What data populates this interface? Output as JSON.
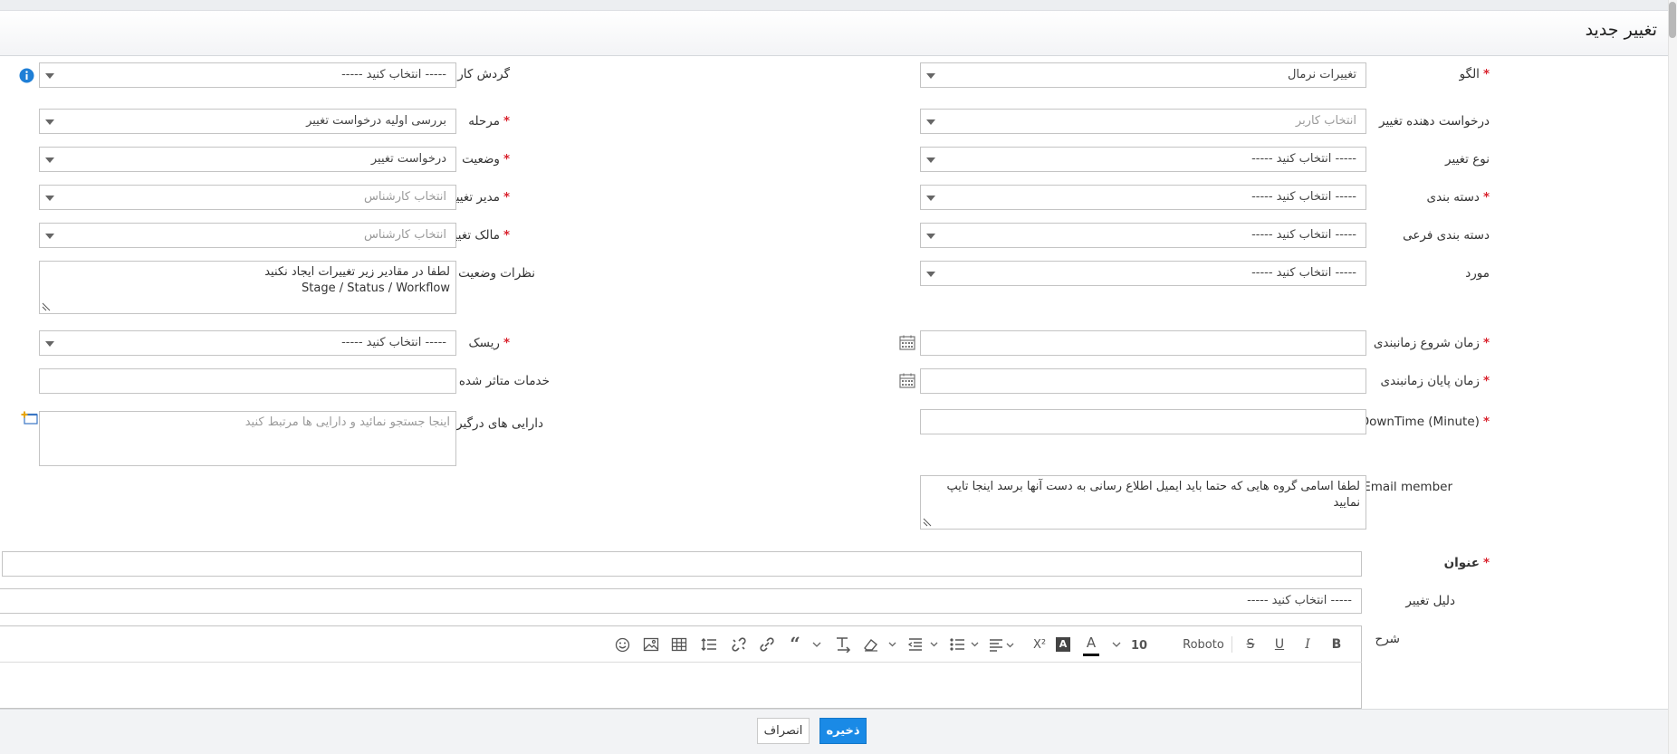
{
  "header": {
    "title": "تغییر جدید"
  },
  "right": {
    "pattern": {
      "label": "الگو",
      "value": "تغییرات نرمال"
    },
    "requester": {
      "label": "درخواست دهنده تغییر",
      "placeholder": "انتخاب کاربر"
    },
    "change_type": {
      "label": "نوع تغییر",
      "value": "----- انتخاب کنید -----"
    },
    "category": {
      "label": "دسته بندی",
      "value": "----- انتخاب کنید -----"
    },
    "subcategory": {
      "label": "دسته بندی فرعی",
      "value": "----- انتخاب کنید -----"
    },
    "item": {
      "label": "مورد",
      "value": "----- انتخاب کنید -----"
    },
    "sched_start": {
      "label": "زمان شروع زمانبندی"
    },
    "sched_end": {
      "label": "زمان پایان زمانبندی"
    },
    "downtime": {
      "label": "DownTime (Minute)"
    },
    "email_member": {
      "label": "Email member",
      "value": "لطفا اسامی گروه هایی که حتما باید ایمیل اطلاع رسانی به دست آنها برسد اینجا تایپ نمایید"
    }
  },
  "left": {
    "workflow": {
      "label": "گردش کار",
      "value": "----- انتخاب کنید -----"
    },
    "stage": {
      "label": "مرحله",
      "value": "بررسی اولیه درخواست تغییر"
    },
    "status": {
      "label": "وضعیت",
      "value": "درخواست تغییر"
    },
    "change_manager": {
      "label": "مدیر تغییر",
      "placeholder": "انتخاب کارشناس"
    },
    "change_owner": {
      "label": "مالک تغییر",
      "placeholder": "انتخاب کارشناس"
    },
    "status_comments": {
      "label": "نظرات وضعیت",
      "line1": "لطفا در مقادیر زیر تغییرات ایجاد نکنید",
      "line2": "Stage / Status / Workflow"
    },
    "risk": {
      "label": "ریسک",
      "value": "----- انتخاب کنید -----"
    },
    "affected_services": {
      "label": "خدمات متاثر شده"
    },
    "involved_assets": {
      "label": "دارایی های درگیر",
      "placeholder": "اینجا جستجو  نمائید و دارایی ها مرتبط کنید"
    }
  },
  "full": {
    "subject": {
      "label": "عنوان"
    },
    "reason": {
      "label": "دلیل تغییر",
      "value": "----- انتخاب کنید -----"
    },
    "description": {
      "label": "شرح"
    }
  },
  "editor": {
    "font_name": "Roboto",
    "font_size": "10"
  },
  "buttons": {
    "save": "ذخیره",
    "cancel": "انصراف"
  }
}
